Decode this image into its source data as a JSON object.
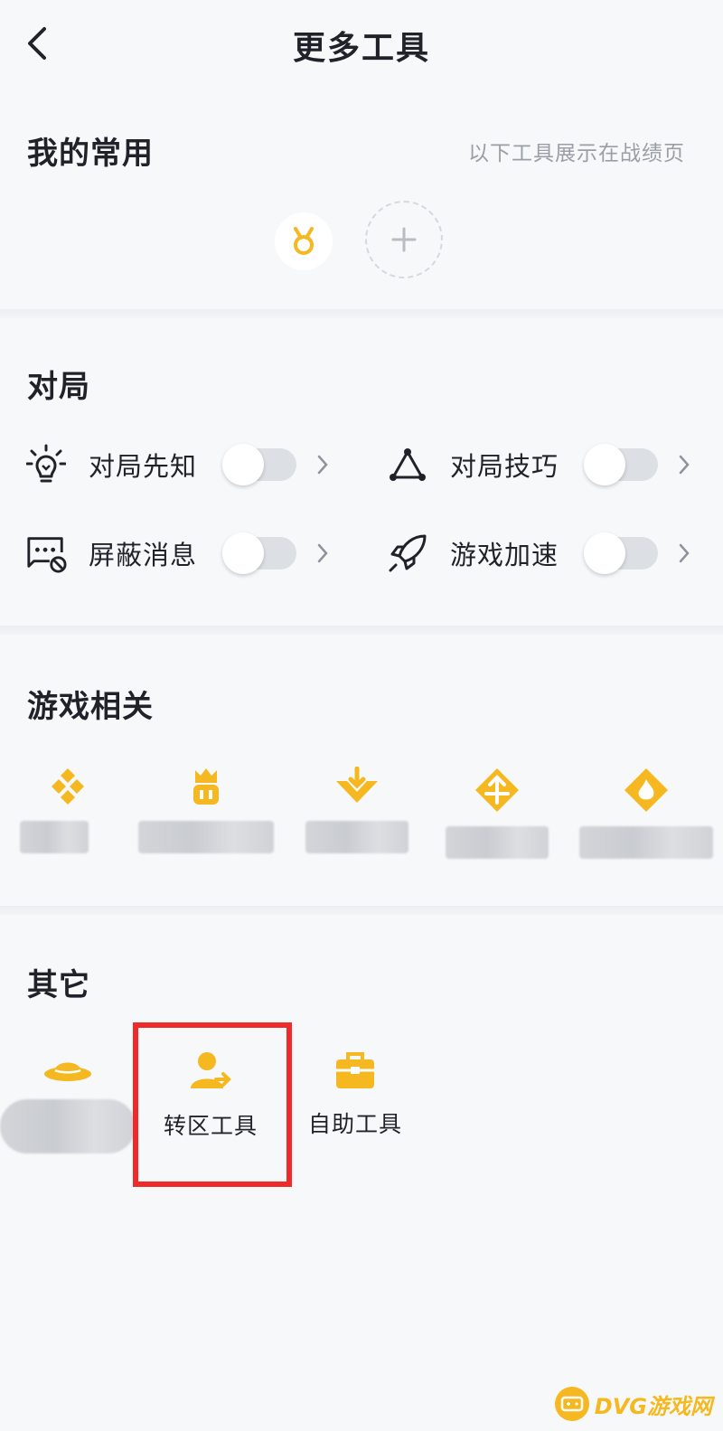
{
  "header": {
    "title": "更多工具"
  },
  "favorites": {
    "title": "我的常用",
    "hint": "以下工具展示在战绩页",
    "items": [
      {
        "icon": "medal-icon"
      }
    ],
    "add_icon": "plus-icon"
  },
  "match": {
    "title": "对局",
    "items": [
      {
        "label": "对局先知",
        "icon": "lightbulb-icon",
        "enabled": false
      },
      {
        "label": "对局技巧",
        "icon": "triangle-nodes-icon",
        "enabled": false
      },
      {
        "label": "屏蔽消息",
        "icon": "message-block-icon",
        "enabled": false
      },
      {
        "label": "游戏加速",
        "icon": "rocket-icon",
        "enabled": false
      }
    ]
  },
  "game_related": {
    "title": "游戏相关",
    "items": [
      {
        "icon": "diamond-cluster-icon"
      },
      {
        "icon": "hero-icon"
      },
      {
        "icon": "arrow-down-badge-icon"
      },
      {
        "icon": "arrow-diamond-icon"
      },
      {
        "icon": "fire-diamond-icon"
      }
    ]
  },
  "others": {
    "title": "其它",
    "items": [
      {
        "icon": "hat-icon",
        "label": ""
      },
      {
        "icon": "user-transfer-icon",
        "label": "转区工具"
      },
      {
        "icon": "toolbox-icon",
        "label": "自助工具"
      }
    ]
  },
  "watermark": {
    "text": "DVG游戏网"
  },
  "colors": {
    "accent": "#f5b820",
    "highlight": "#ee2a2a",
    "background": "#f7f8fa"
  }
}
